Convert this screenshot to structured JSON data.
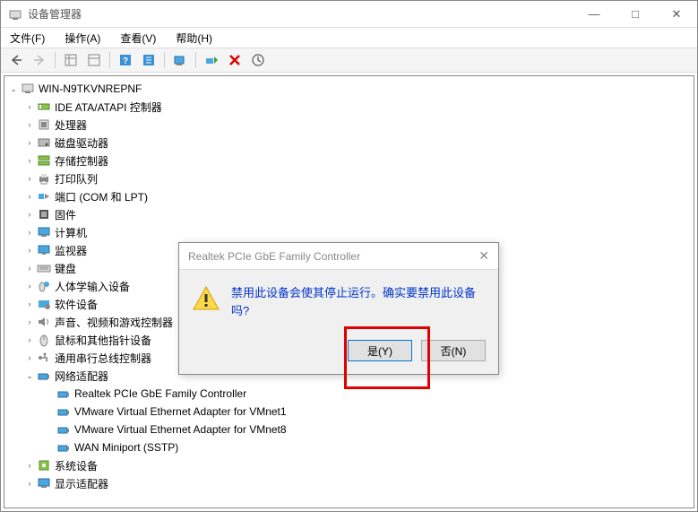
{
  "window": {
    "title": "设备管理器",
    "controls": {
      "minimize": "—",
      "maximize": "□",
      "close": "✕"
    }
  },
  "menubar": {
    "file": "文件(F)",
    "action": "操作(A)",
    "view": "查看(V)",
    "help": "帮助(H)"
  },
  "tree": {
    "root": "WIN-N9TKVNREPNF",
    "items": [
      "IDE ATA/ATAPI 控制器",
      "处理器",
      "磁盘驱动器",
      "存储控制器",
      "打印队列",
      "端口 (COM 和 LPT)",
      "固件",
      "计算机",
      "监视器",
      "键盘",
      "人体学输入设备",
      "软件设备",
      "声音、视频和游戏控制器",
      "鼠标和其他指针设备",
      "通用串行总线控制器"
    ],
    "network": {
      "label": "网络适配器",
      "children": [
        "Realtek PCIe GbE Family Controller",
        "VMware Virtual Ethernet Adapter for VMnet1",
        "VMware Virtual Ethernet Adapter for VMnet8",
        "WAN Miniport (SSTP)"
      ]
    },
    "after": [
      "系统设备",
      "显示适配器"
    ]
  },
  "dialog": {
    "title": "Realtek PCIe GbE Family Controller",
    "message": "禁用此设备会使其停止运行。确实要禁用此设备吗?",
    "yes": "是(Y)",
    "no": "否(N)",
    "close": "✕"
  }
}
